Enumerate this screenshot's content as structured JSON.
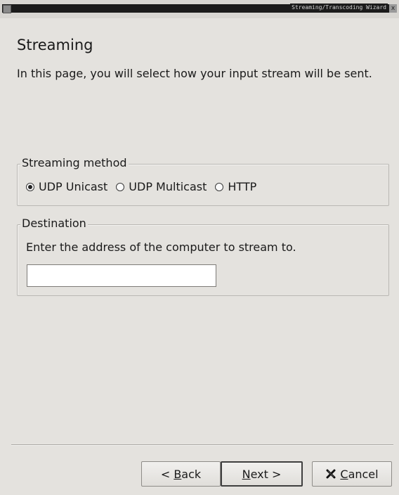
{
  "window": {
    "title": "Streaming/Transcoding Wizard",
    "close_glyph": "x"
  },
  "page": {
    "title": "Streaming",
    "description": "In this page, you will select how your input stream will be sent."
  },
  "streaming_method": {
    "legend": "Streaming method",
    "options": [
      {
        "label": "UDP Unicast",
        "selected": true
      },
      {
        "label": "UDP Multicast",
        "selected": false
      },
      {
        "label": "HTTP",
        "selected": false
      }
    ]
  },
  "destination": {
    "legend": "Destination",
    "prompt": "Enter the address of the computer to stream to.",
    "value": ""
  },
  "buttons": {
    "back": {
      "prefix": "< ",
      "mnemonic": "B",
      "rest": "ack"
    },
    "next": {
      "mnemonic": "N",
      "rest": "ext >"
    },
    "cancel": {
      "mnemonic": "C",
      "rest": "ancel",
      "icon": "cancel-x-icon",
      "icon_color": "#111111"
    }
  }
}
